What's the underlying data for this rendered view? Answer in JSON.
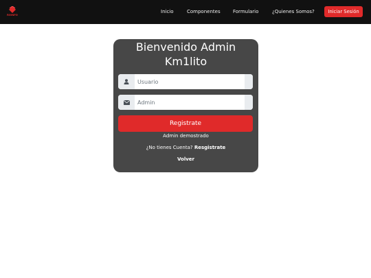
{
  "navbar": {
    "logo_text": "ROINFO",
    "links": [
      "Inicio",
      "Componentes",
      "Formulario",
      "¿Quienes Somos?"
    ],
    "login_label": "Iniciar Sesión"
  },
  "card": {
    "title_line1": "Bienvenido Admin",
    "title_line2": "Km1lito",
    "username_placeholder": "Usuario",
    "admin_placeholder": "Admin",
    "register_label": "Registrate",
    "demo_text": "Admin demostrado",
    "no_account_text": "¿No tienes Cuenta?",
    "register_link": "Resgistrate",
    "back_label": "Volver"
  },
  "colors": {
    "accent": "#e02a2a",
    "navbar_bg": "#111111",
    "card_bg": "#474747"
  }
}
